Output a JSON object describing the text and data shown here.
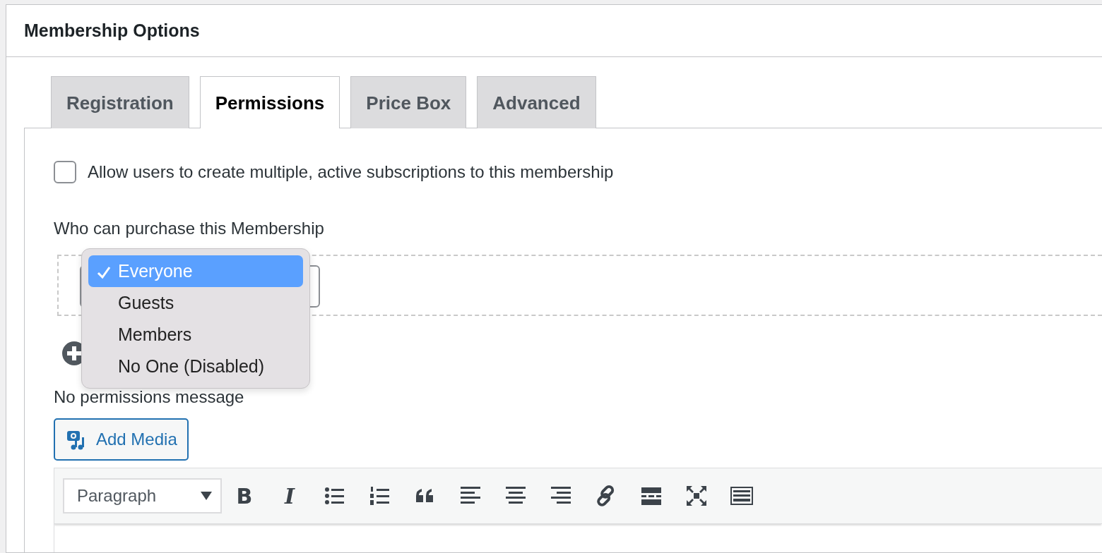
{
  "panel": {
    "title": "Membership Options"
  },
  "tabs": [
    {
      "label": "Registration",
      "selected": false
    },
    {
      "label": "Permissions",
      "selected": true
    },
    {
      "label": "Price Box",
      "selected": false
    },
    {
      "label": "Advanced",
      "selected": false
    }
  ],
  "multiple_subscriptions": {
    "label": "Allow users to create multiple, active subscriptions to this membership",
    "checked": false
  },
  "purchase": {
    "label": "Who can purchase this Membership",
    "options": [
      {
        "label": "Everyone",
        "selected": true
      },
      {
        "label": "Guests",
        "selected": false
      },
      {
        "label": "Members",
        "selected": false
      },
      {
        "label": "No One (Disabled)",
        "selected": false
      }
    ]
  },
  "message": {
    "label": "No permissions message",
    "add_media": "Add Media",
    "format": "Paragraph",
    "toolbar": [
      {
        "kind": "bold",
        "label": "B"
      },
      {
        "kind": "italic",
        "label": "I"
      },
      {
        "kind": "bullets"
      },
      {
        "kind": "numbers"
      },
      {
        "kind": "quote"
      },
      {
        "kind": "align-left"
      },
      {
        "kind": "align-center"
      },
      {
        "kind": "align-right"
      },
      {
        "kind": "link"
      },
      {
        "kind": "more"
      },
      {
        "kind": "fullscreen"
      },
      {
        "kind": "keyboard"
      }
    ]
  }
}
